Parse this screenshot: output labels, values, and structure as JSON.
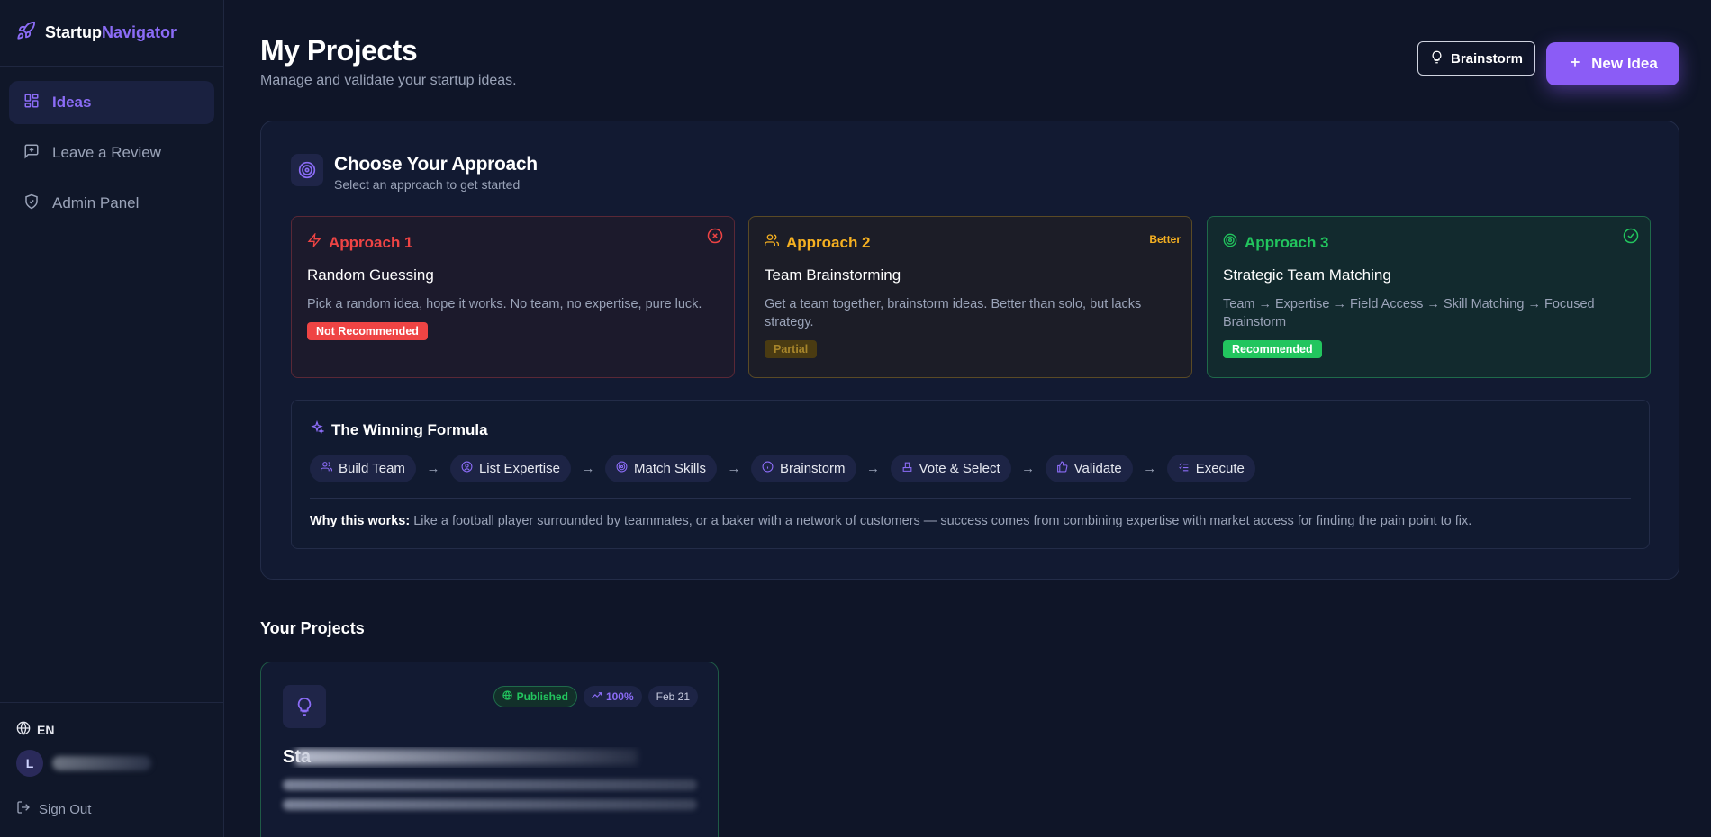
{
  "brand": {
    "part1": "Startup",
    "part2": "Navigator"
  },
  "sidebar": {
    "items": [
      {
        "label": "Ideas",
        "icon": "grid-icon",
        "active": true
      },
      {
        "label": "Leave a Review",
        "icon": "message-plus-icon",
        "active": false
      },
      {
        "label": "Admin Panel",
        "icon": "shield-check-icon",
        "active": false
      }
    ],
    "language": "EN",
    "avatar_initial": "L",
    "sign_out": "Sign Out"
  },
  "header": {
    "title": "My Projects",
    "subtitle": "Manage and validate your startup ideas.",
    "brainstorm_label": "Brainstorm",
    "new_idea_label": "New Idea"
  },
  "approach": {
    "title": "Choose Your Approach",
    "subtitle": "Select an approach to get started",
    "cards": [
      {
        "label": "Approach 1",
        "title": "Random Guessing",
        "desc": "Pick a random idea, hope it works. No team, no expertise, pure luck.",
        "pill": "Not Recommended",
        "color": "#ef4444"
      },
      {
        "label": "Approach 2",
        "title": "Team Brainstorming",
        "desc": "Get a team together, brainstorm ideas. Better than solo, but lacks strategy.",
        "pill": "Partial",
        "tag": "Better",
        "color": "#f5b021"
      },
      {
        "label": "Approach 3",
        "title": "Strategic Team Matching",
        "desc": "Team → Expertise → Field Access → Skill Matching → Focused Brainstorm",
        "pill": "Recommended",
        "color": "#22c55e"
      }
    ]
  },
  "formula": {
    "title": "The Winning Formula",
    "steps": [
      {
        "label": "Build Team",
        "icon": "users-icon"
      },
      {
        "label": "List Expertise",
        "icon": "user-circle-icon"
      },
      {
        "label": "Match Skills",
        "icon": "target-icon"
      },
      {
        "label": "Brainstorm",
        "icon": "info-icon"
      },
      {
        "label": "Vote & Select",
        "icon": "vote-icon"
      },
      {
        "label": "Validate",
        "icon": "thumbs-up-icon"
      },
      {
        "label": "Execute",
        "icon": "list-check-icon"
      }
    ],
    "why_label": "Why this works:",
    "why_text": "Like a football player surrounded by teammates, or a baker with a network of customers — success comes from combining expertise with market access for finding the pain point to fix."
  },
  "projects": {
    "heading": "Your Projects",
    "items": [
      {
        "status": "Published",
        "progress": "100%",
        "date": "Feb 21",
        "title": "Sta"
      }
    ]
  },
  "colors": {
    "accent": "#8b5cf6",
    "bg": "#0f1528"
  }
}
